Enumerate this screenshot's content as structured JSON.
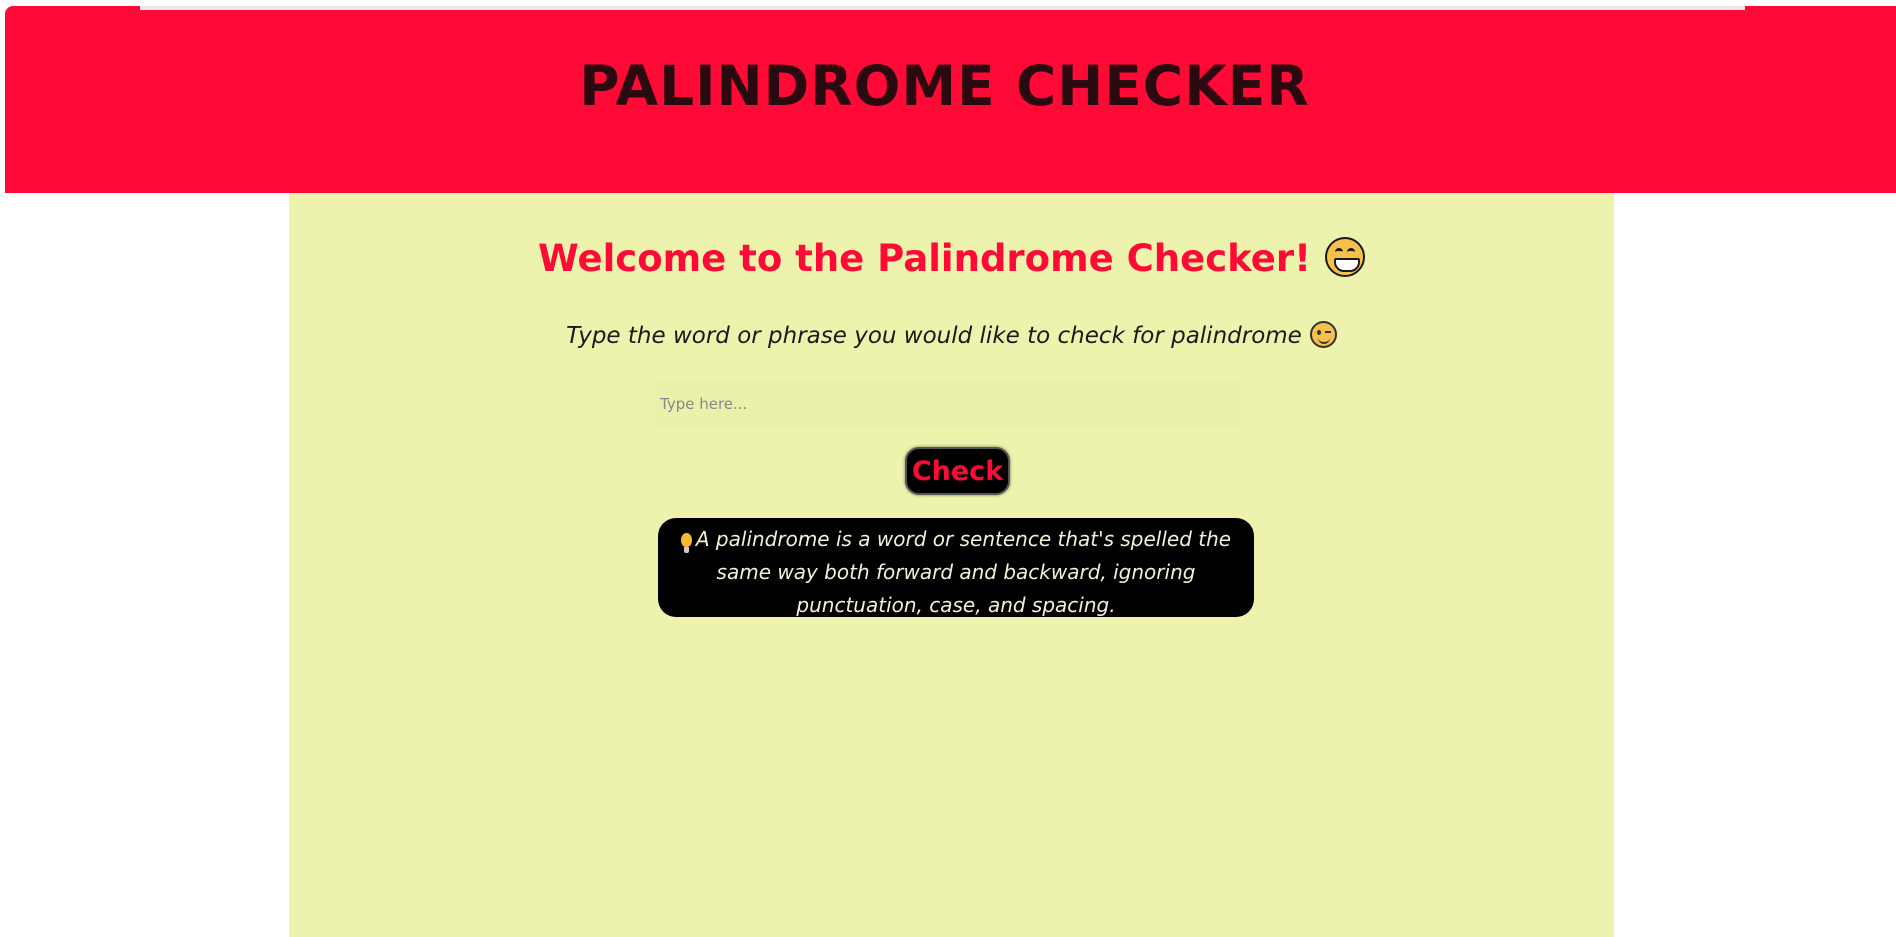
{
  "header": {
    "title": "PALINDROME CHECKER"
  },
  "main": {
    "welcome": "Welcome to the Palindrome Checker!",
    "prompt": "Type the word or phrase you would like to check for palindrome",
    "input": {
      "placeholder": "Type here...",
      "value": ""
    },
    "check_label": "Check",
    "info_text": "A palindrome is a word or sentence that's spelled the same way both forward and backward, ignoring punctuation, case, and spacing."
  },
  "icons": {
    "welcome_emoji": "grinning-face-icon",
    "prompt_emoji": "winking-face-icon",
    "info_emoji": "light-bulb-icon"
  },
  "colors": {
    "header_bg": "#ff0a36",
    "panel_bg": "#edf3ad",
    "accent": "#ff0a36",
    "button_bg": "#000000",
    "info_bg": "#000000"
  }
}
